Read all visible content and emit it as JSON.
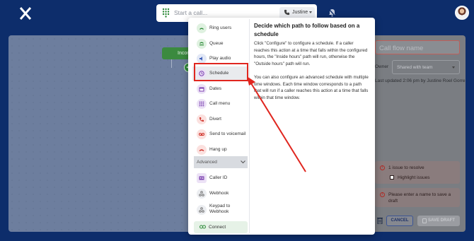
{
  "topbar": {
    "call_placeholder": "Start a call...",
    "caller_name": "Justine",
    "icons": [
      "x-logo-icon",
      "dialpad-icon",
      "phone-icon",
      "bell-off-icon",
      "avatar"
    ]
  },
  "canvas": {
    "incoming_label": "Incom",
    "add_symbol": "+"
  },
  "menu": {
    "items": [
      {
        "label": "Ring users",
        "icon": "ring-users-icon"
      },
      {
        "label": "Queue",
        "icon": "queue-icon"
      },
      {
        "label": "Play audio",
        "icon": "play-audio-icon"
      },
      {
        "label": "Schedule",
        "icon": "clock-icon"
      },
      {
        "label": "Dates",
        "icon": "calendar-icon"
      },
      {
        "label": "Call menu",
        "icon": "dialpad-icon"
      },
      {
        "label": "Divert",
        "icon": "divert-icon"
      },
      {
        "label": "Send to voicemail",
        "icon": "voicemail-icon"
      },
      {
        "label": "Hang up",
        "icon": "hang-up-icon"
      }
    ],
    "advanced_label": "Advanced",
    "advanced_items": [
      {
        "label": "Caller ID",
        "icon": "caller-id-icon"
      },
      {
        "label": "Webhook",
        "icon": "webhook-icon"
      },
      {
        "label": "Keypad to Webhook",
        "icon": "keypad-webhook-icon"
      }
    ],
    "connect_label": "Connect",
    "description": {
      "title": "Decide which path to follow based on a schedule",
      "p1": "Click \"Configure\" to configure a schedule. If a caller reaches this action at a time that falls within the configured hours, the \"Inside hours\" path will run, otherwise the \"Outside hours\" path will run.",
      "p2": "You can also configure an advanced schedule with multiple time windows. Each time window corresponds to a path that will run if a caller reaches this action at a time that falls within that time window."
    }
  },
  "panel": {
    "flow_name_placeholder": "Call flow name",
    "owner_label": "Owner",
    "owner_placeholder": "Shared with team",
    "last_updated": "Last updated 2:06 pm by Justine Roel Gorre",
    "issue_text": "1 issue to resolve",
    "highlight_label": "Highlight issues",
    "name_error": "Please enter a name to save a draft",
    "cancel_label": "CANCEL",
    "save_label": "SAVE DRAFT"
  },
  "colors": {
    "topbar": "#0d2d6b",
    "highlight_box": "#e0261f",
    "incoming_node": "#3b8a3f"
  }
}
